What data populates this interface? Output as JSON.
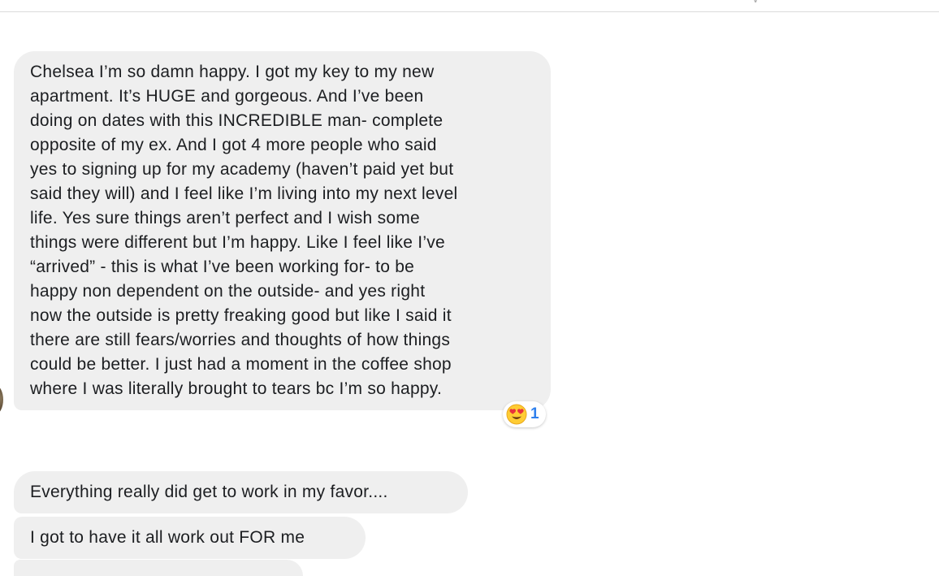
{
  "messages": [
    {
      "lines": [
        "Chelsea I’m so damn happy. I got my key to my new",
        "apartment. It’s HUGE and gorgeous. And I’ve been",
        "doing on dates with this INCREDIBLE man- complete",
        "opposite of my ex. And I got 4 more people who said",
        "yes to signing up for my academy (haven’t paid yet but",
        "said they will) and I feel like I’m living into my next level",
        "life. Yes sure things aren’t perfect and I wish some",
        "things were different but I’m happy. Like I feel like I’ve",
        "“arrived” - this is what I’ve been working for- to be",
        "happy non dependent on the outside- and yes right",
        "now the outside is pretty freaking good but like I said it",
        "there are still fears/worries and thoughts of how things",
        "could be better. I just had a moment in the coffee shop",
        "where I was literally brought to tears bc I’m so happy."
      ],
      "reaction": {
        "emoji": "heart-eyes-face-icon",
        "count": "1"
      }
    },
    {
      "text": "Everything really did get to work in my favor...."
    },
    {
      "text": "I got to have it all work out FOR me"
    }
  ],
  "colors": {
    "bubble": "#efefef",
    "text": "#1c1e21",
    "reaction_count": "#2f80ed",
    "divider": "#dcdcdc"
  }
}
